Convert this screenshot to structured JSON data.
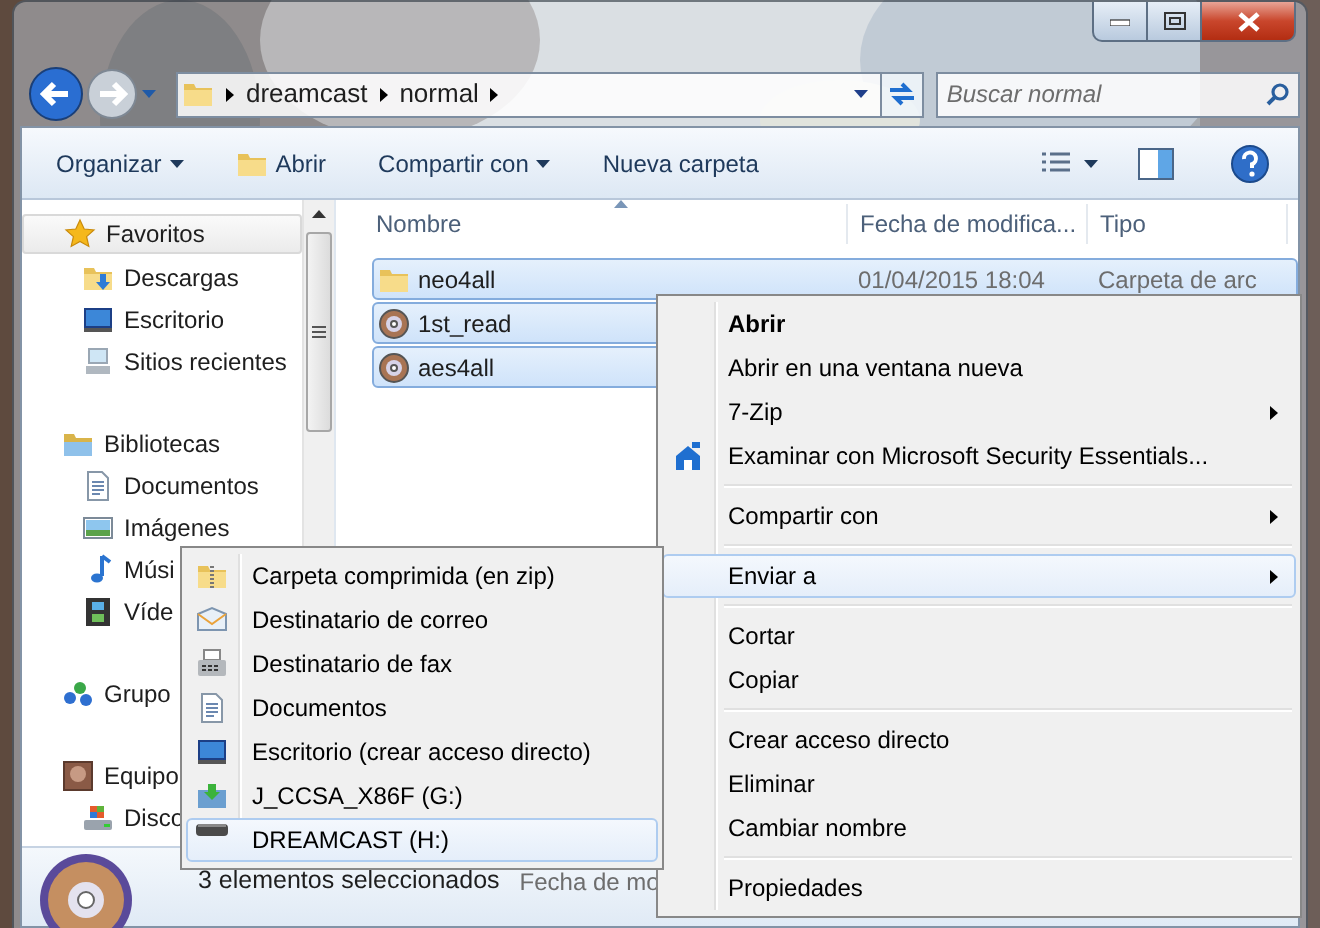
{
  "address_bar": {
    "path": [
      "dreamcast",
      "normal"
    ]
  },
  "search": {
    "placeholder": "Buscar normal"
  },
  "toolbar": {
    "buttons": [
      {
        "label": "Organizar",
        "kind": "menu"
      },
      {
        "label": "Abrir",
        "kind": "open"
      },
      {
        "label": "Compartir con",
        "kind": "menu"
      },
      {
        "label": "Nueva carpeta",
        "kind": "plain"
      }
    ]
  },
  "sidebar": {
    "groups": [
      {
        "label": "Favoritos",
        "kind": "star",
        "selected": true,
        "children": [
          {
            "label": "Descargas",
            "kind": "downloads",
            "selected": false
          },
          {
            "label": "Escritorio",
            "kind": "desktop",
            "selected": false
          },
          {
            "label": "Sitios recientes",
            "kind": "recent",
            "selected": false
          }
        ]
      },
      {
        "label": "Bibliotecas",
        "kind": "libraries",
        "selected": false,
        "children": [
          {
            "label": "Documentos",
            "kind": "document",
            "selected": false
          },
          {
            "label": "Imágenes",
            "kind": "images",
            "selected": false
          },
          {
            "label": "Músi",
            "kind": "music",
            "selected": false
          },
          {
            "label": "Víde",
            "kind": "video",
            "selected": false
          }
        ]
      },
      {
        "label": "Grupo",
        "kind": "homegroup",
        "selected": false
      },
      {
        "label": "Equipo",
        "kind": "user",
        "selected": false,
        "children": [
          {
            "label": "Disco",
            "kind": "drive",
            "selected": false
          }
        ]
      }
    ]
  },
  "file_list": {
    "columns": [
      "Nombre",
      "Fecha de modifica...",
      "Tipo"
    ],
    "rows": [
      {
        "name": "neo4all",
        "kind": "folder",
        "date": "01/04/2015 18:04",
        "type": "Carpeta de arc",
        "selected": true
      },
      {
        "name": "1st_read",
        "kind": "disc",
        "selected": true
      },
      {
        "name": "aes4all",
        "kind": "disc",
        "selected": true
      }
    ]
  },
  "status_bar": {
    "selection": "3 elementos seleccionados",
    "detail": "Fecha de mo"
  },
  "context_menu": {
    "items": [
      {
        "kind": "command",
        "label": "Abrir",
        "default": true,
        "submenu": false,
        "selected": false
      },
      {
        "kind": "command",
        "label": "Abrir en una ventana nueva",
        "default": false,
        "submenu": false,
        "selected": false
      },
      {
        "kind": "command",
        "label": "7-Zip",
        "default": false,
        "submenu": true,
        "selected": false
      },
      {
        "kind": "scan",
        "label": "Examinar con Microsoft Security Essentials...",
        "default": false,
        "submenu": false,
        "selected": false
      },
      {
        "kind": "separator"
      },
      {
        "kind": "command",
        "label": "Compartir con",
        "default": false,
        "submenu": true,
        "selected": false
      },
      {
        "kind": "separator"
      },
      {
        "kind": "command",
        "label": "Enviar a",
        "default": false,
        "submenu": true,
        "selected": true
      },
      {
        "kind": "separator"
      },
      {
        "kind": "command",
        "label": "Cortar",
        "default": false,
        "submenu": false,
        "selected": false
      },
      {
        "kind": "command",
        "label": "Copiar",
        "default": false,
        "submenu": false,
        "selected": false
      },
      {
        "kind": "separator"
      },
      {
        "kind": "command",
        "label": "Crear acceso directo",
        "default": false,
        "submenu": false,
        "selected": false
      },
      {
        "kind": "command",
        "label": "Eliminar",
        "default": false,
        "submenu": false,
        "selected": false
      },
      {
        "kind": "command",
        "label": "Cambiar nombre",
        "default": false,
        "submenu": false,
        "selected": false
      },
      {
        "kind": "separator"
      },
      {
        "kind": "command",
        "label": "Propiedades",
        "default": false,
        "submenu": false,
        "selected": false
      }
    ]
  },
  "send_to_menu": {
    "items": [
      {
        "label": "Carpeta comprimida (en zip)",
        "kind": "zip",
        "selected": false
      },
      {
        "label": "Destinatario de correo",
        "kind": "mail",
        "selected": false
      },
      {
        "label": "Destinatario de fax",
        "kind": "fax",
        "selected": false
      },
      {
        "label": "Documentos",
        "kind": "document",
        "selected": false
      },
      {
        "label": "Escritorio (crear acceso directo)",
        "kind": "desktop",
        "selected": false
      },
      {
        "label": "J_CCSA_X86F (G:)",
        "kind": "usb",
        "selected": false
      },
      {
        "label": "DREAMCAST (H:)",
        "kind": "removable",
        "selected": true
      }
    ]
  }
}
